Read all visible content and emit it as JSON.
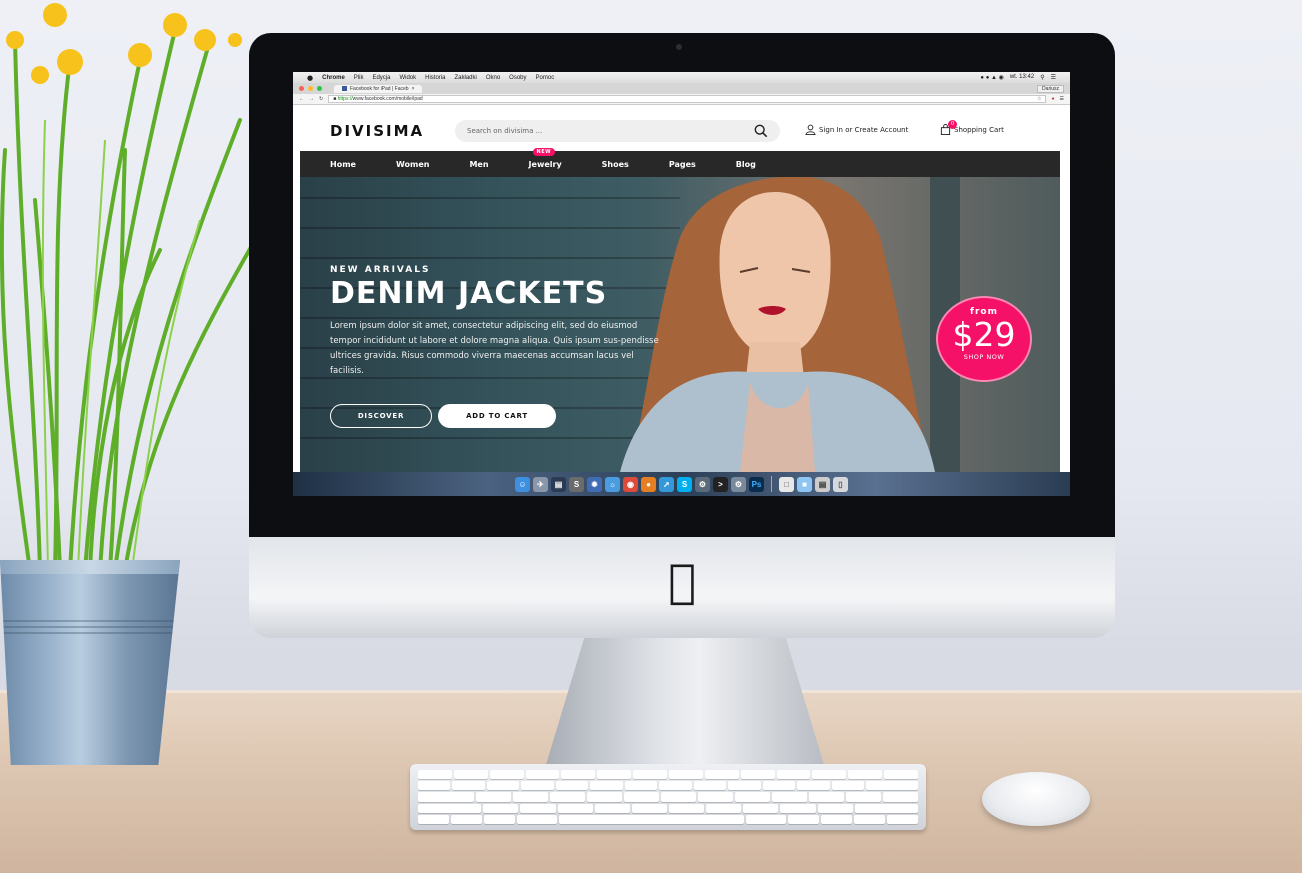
{
  "menubar": {
    "app": "Chrome",
    "items": [
      "Plik",
      "Edycja",
      "Widok",
      "Historia",
      "Zakładki",
      "Okno",
      "Osoby",
      "Pomoc"
    ],
    "clock": "wt. 13:42"
  },
  "browser": {
    "tab_title": "Facebook for iPad | Faceb",
    "user": "Dariusz",
    "url_scheme": "https://",
    "url_rest": "www.facebook.com/mobile/ipad"
  },
  "site": {
    "logo": "DIVISIMA",
    "search_placeholder": "Search on divisima ...",
    "signin": "Sign In or Create Account",
    "cart_label": "Shopping Cart",
    "cart_count": "0",
    "nav": [
      "Home",
      "Women",
      "Men",
      "Jewelry",
      "Shoes",
      "Pages",
      "Blog"
    ],
    "nav_badge": "NEW"
  },
  "hero": {
    "kicker": "NEW ARRIVALS",
    "headline": "DENIM JACKETS",
    "body": "Lorem ipsum dolor sit amet, consectetur adipiscing elit, sed do eiusmod tempor incididunt ut labore et dolore magna aliqua. Quis ipsum sus-pendisse ultrices gravida. Risus commodo viverra maecenas accumsan lacus vel facilisis.",
    "discover_label": "DISCOVER",
    "add_to_cart_label": "ADD TO CART",
    "price_from": "from",
    "price": "$29",
    "shop_now": "SHOP NOW"
  },
  "colors": {
    "accent": "#f51167",
    "nav_bg": "#282828"
  }
}
